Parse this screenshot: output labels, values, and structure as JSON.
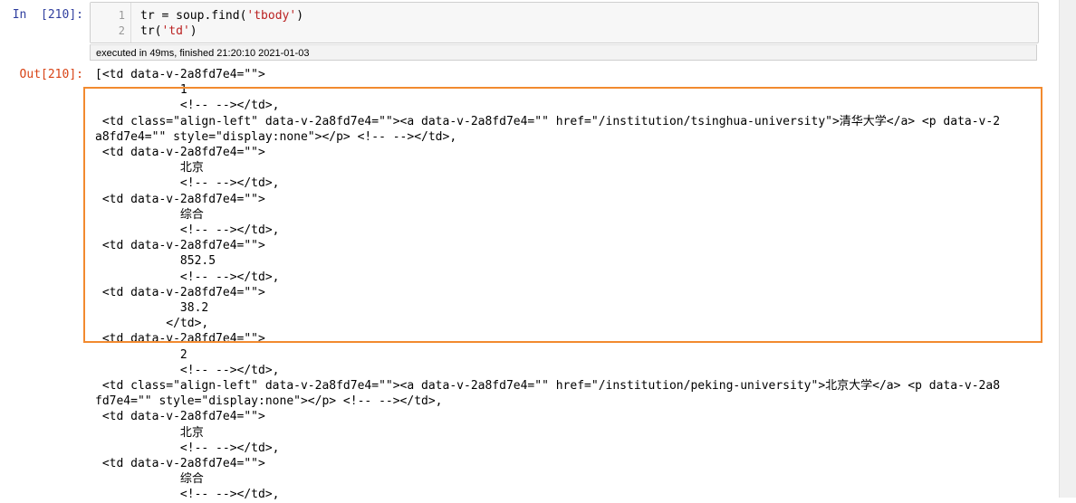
{
  "cell": {
    "in_prompt": "In  [210]:",
    "out_prompt": "Out[210]:",
    "code_lines": [
      {
        "num": "1",
        "pre": "tr = soup.find(",
        "str": "'tbody'",
        "post": ")"
      },
      {
        "num": "2",
        "pre": "tr(",
        "str": "'td'",
        "post": ")"
      }
    ],
    "exec_info": "executed in 49ms, finished 21:20:10 2021-01-03"
  },
  "output": {
    "lines": [
      "[<td data-v-2a8fd7e4=\"\">",
      "            1",
      "            <!-- --></td>,",
      " <td class=\"align-left\" data-v-2a8fd7e4=\"\"><a data-v-2a8fd7e4=\"\" href=\"/institution/tsinghua-university\">清华大学</a> <p data-v-2",
      "a8fd7e4=\"\" style=\"display:none\"></p> <!-- --></td>,",
      " <td data-v-2a8fd7e4=\"\">",
      "            北京",
      "            <!-- --></td>,",
      " <td data-v-2a8fd7e4=\"\">",
      "            综合",
      "            <!-- --></td>,",
      " <td data-v-2a8fd7e4=\"\">",
      "            852.5",
      "            <!-- --></td>,",
      " <td data-v-2a8fd7e4=\"\">",
      "            38.2",
      "          </td>,",
      " <td data-v-2a8fd7e4=\"\">",
      "            2",
      "            <!-- --></td>,",
      " <td class=\"align-left\" data-v-2a8fd7e4=\"\"><a data-v-2a8fd7e4=\"\" href=\"/institution/peking-university\">北京大学</a> <p data-v-2a8",
      "fd7e4=\"\" style=\"display:none\"></p> <!-- --></td>,",
      " <td data-v-2a8fd7e4=\"\">",
      "            北京",
      "            <!-- --></td>,",
      " <td data-v-2a8fd7e4=\"\">",
      "            综合",
      "            <!-- --></td>,"
    ]
  },
  "colors": {
    "highlight_border": "#f28a2f",
    "in_prompt": "#303f9f",
    "out_prompt": "#d84315",
    "string": "#ba2121"
  }
}
